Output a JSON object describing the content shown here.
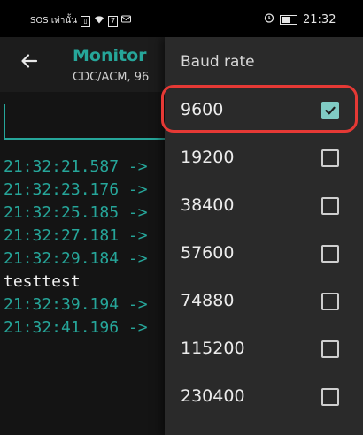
{
  "status_bar": {
    "left_text": "SOS เท่านั้น",
    "time": "21:32",
    "battery_level": 0.55
  },
  "app_bar": {
    "title": "Monitor",
    "subtitle": "CDC/ACM, 96"
  },
  "send": {
    "value": "",
    "placeholder": ""
  },
  "terminal": {
    "lines": [
      {
        "text": "21:32:21.587 ->",
        "kind": "received"
      },
      {
        "text": "21:32:23.176 ->",
        "kind": "received"
      },
      {
        "text": "21:32:25.185 ->",
        "kind": "received"
      },
      {
        "text": "21:32:27.181 ->",
        "kind": "received"
      },
      {
        "text": "21:32:29.184 ->",
        "kind": "received"
      },
      {
        "text": "testtest",
        "kind": "sent"
      },
      {
        "text": "21:32:39.194 ->",
        "kind": "received"
      },
      {
        "text": "21:32:41.196 ->",
        "kind": "received"
      }
    ]
  },
  "baud_menu": {
    "title": "Baud rate",
    "options": [
      {
        "label": "9600",
        "checked": true
      },
      {
        "label": "19200",
        "checked": false
      },
      {
        "label": "38400",
        "checked": false
      },
      {
        "label": "57600",
        "checked": false
      },
      {
        "label": "74880",
        "checked": false
      },
      {
        "label": "115200",
        "checked": false
      },
      {
        "label": "230400",
        "checked": false
      }
    ]
  },
  "colors": {
    "accent": "#26a69a",
    "checkbox_checked": "#80cbc4",
    "highlight": "#e53935"
  }
}
